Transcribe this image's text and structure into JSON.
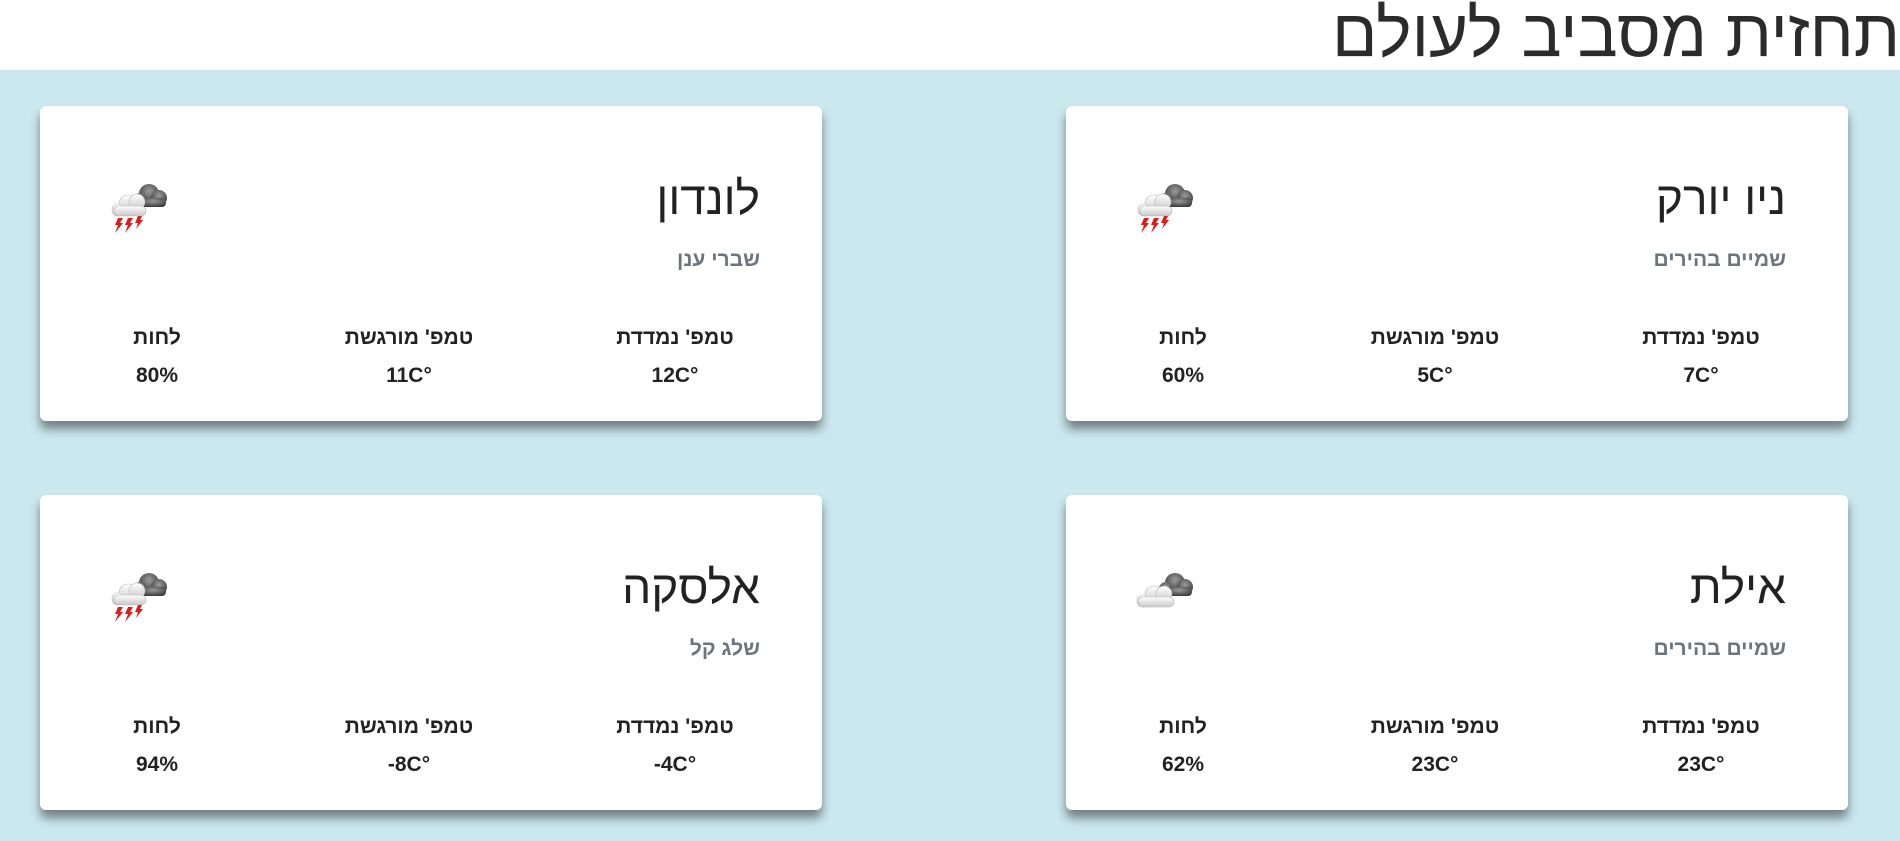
{
  "header": {
    "title": "תחזית מסביב לעולם"
  },
  "labels": {
    "measured": "טמפ' נמדדת",
    "feels": "טמפ' מורגשת",
    "humidity": "לחות"
  },
  "cities": [
    {
      "name": "ניו יורק",
      "description": "שמיים בהירים",
      "measured": "7C°",
      "feels": "5C°",
      "humidity": "60%",
      "icon": "thunderstorm-icon"
    },
    {
      "name": "לונדון",
      "description": "שברי ענן",
      "measured": "12C°",
      "feels": "11C°",
      "humidity": "80%",
      "icon": "thunderstorm-icon"
    },
    {
      "name": "אילת",
      "description": "שמיים בהירים",
      "measured": "23C°",
      "feels": "23C°",
      "humidity": "62%",
      "icon": "cloud-icon"
    },
    {
      "name": "אלסקה",
      "description": "שלג קל",
      "measured": "-4C°",
      "feels": "-8C°",
      "humidity": "94%",
      "icon": "thunderstorm-icon"
    }
  ],
  "colors": {
    "background": "#cbe8ef",
    "card": "#ffffff",
    "description": "#6c757d",
    "lightning": "#e01b1b"
  }
}
